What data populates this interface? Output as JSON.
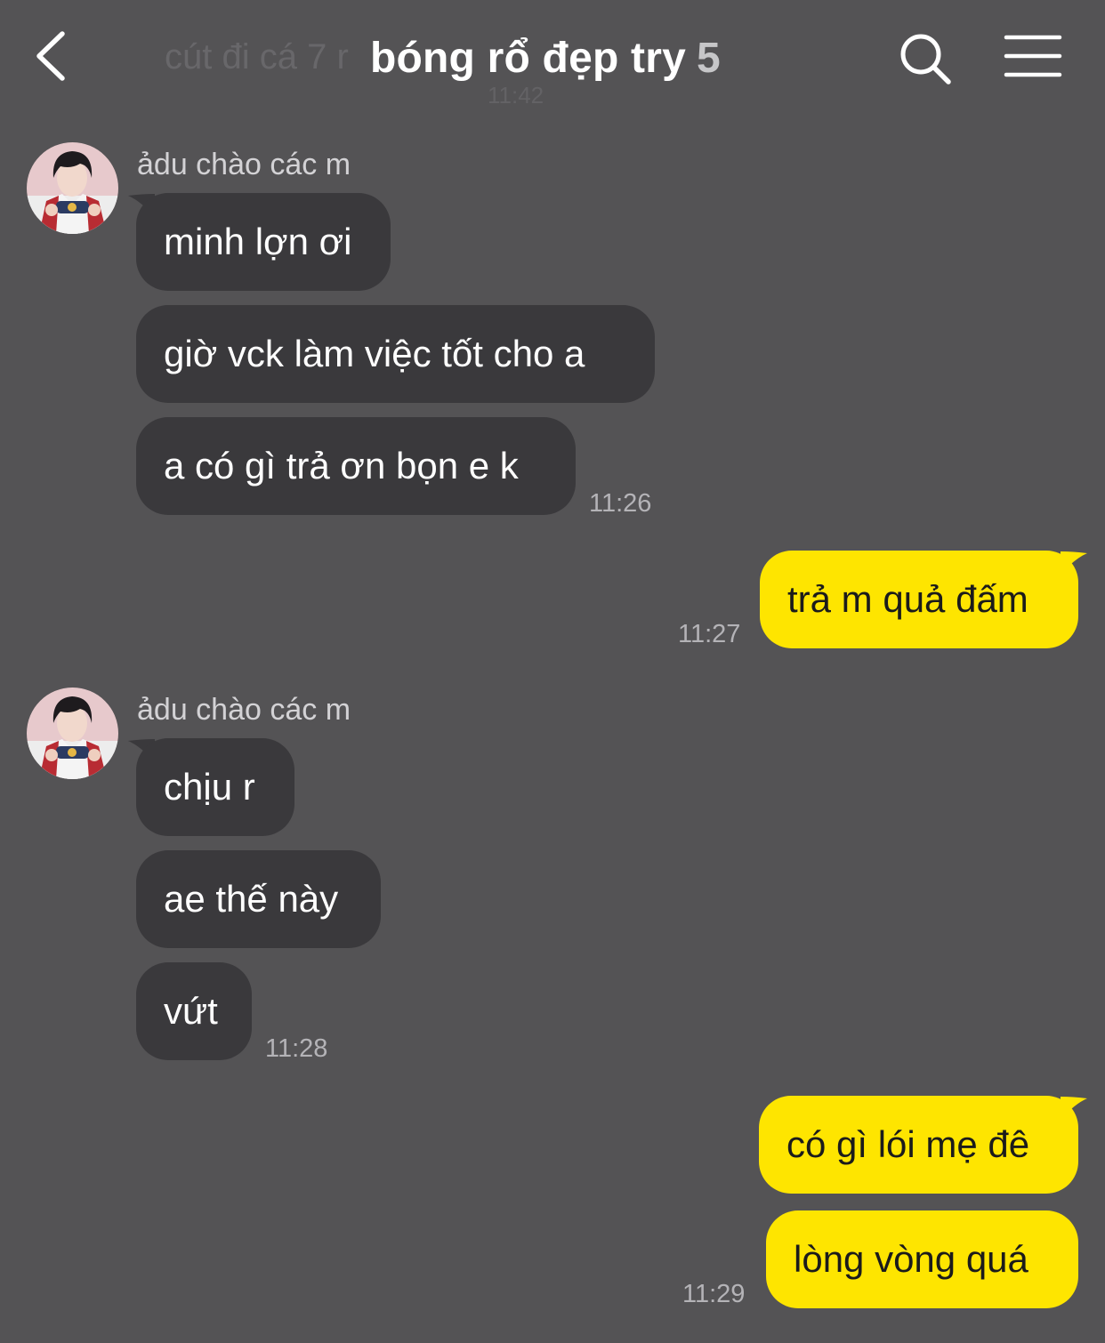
{
  "header": {
    "title": "bóng rổ đẹp try",
    "member_count": "5",
    "ghost_preview": "cút đi cá 7 r",
    "ghost_time": "11:42"
  },
  "colors": {
    "background": "#545355",
    "incoming_bubble": "#3a393c",
    "outgoing_bubble": "#fee500"
  },
  "messages": [
    {
      "sender": "ảdu chào các m",
      "bubbles": [
        "minh lợn ơi",
        "giờ vck làm việc tốt cho a",
        "a có gì trả ơn bọn e k"
      ],
      "time": "11:26"
    },
    {
      "self": true,
      "bubbles": [
        "trả m quả đấm"
      ],
      "time": "11:27"
    },
    {
      "sender": "ảdu chào các m",
      "bubbles": [
        "chịu r",
        "ae thế này",
        "vứt"
      ],
      "time": "11:28"
    },
    {
      "self": true,
      "bubbles": [
        "có gì lói mẹ đê",
        "lòng vòng quá"
      ],
      "time": "11:29"
    }
  ]
}
